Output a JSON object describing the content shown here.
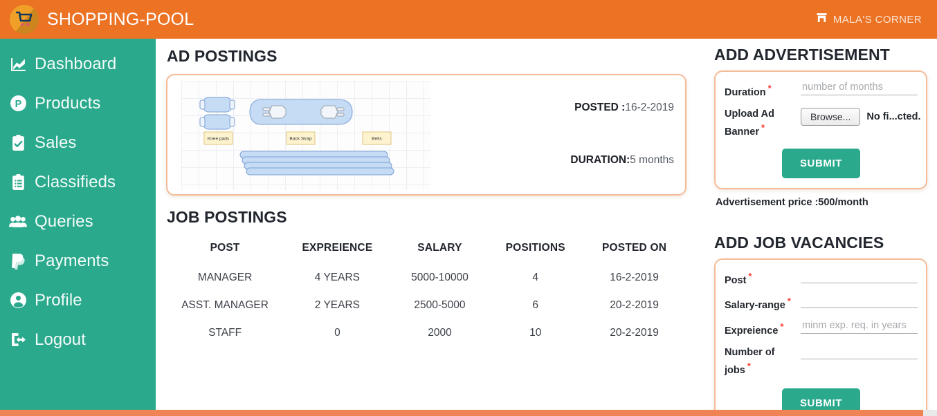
{
  "header": {
    "brand": "SHOPPING-POOL",
    "logo_icon": "shopping-cart-icon",
    "user_icon": "store-icon",
    "user_name": "MALA'S CORNER",
    "bg_color": "#ec7224"
  },
  "sidebar": {
    "bg_color": "#2aa98c",
    "items": [
      {
        "label": "Dashboard",
        "icon": "chart-line-icon"
      },
      {
        "label": "Products",
        "icon": "product-p-circle-icon"
      },
      {
        "label": "Sales",
        "icon": "clipboard-check-icon"
      },
      {
        "label": "Classifieds",
        "icon": "clipboard-list-icon"
      },
      {
        "label": "Queries",
        "icon": "users-icon"
      },
      {
        "label": "Payments",
        "icon": "paypal-icon"
      },
      {
        "label": "Profile",
        "icon": "user-circle-icon"
      },
      {
        "label": "Logout",
        "icon": "sign-out-icon"
      }
    ]
  },
  "main": {
    "ad_postings_title": "AD POSTINGS",
    "ad": {
      "posted_label": "POSTED :",
      "posted_value": "16-2-2019",
      "duration_label": "DURATION:",
      "duration_value": "5 months",
      "banner": {
        "alt": "advertisement banner diagram",
        "labels": [
          "Knee pads",
          "Back Strap",
          "Belts"
        ]
      }
    },
    "job_postings_title": "JOB POSTINGS",
    "jobs_table": {
      "columns": [
        "POST",
        "EXPREIENCE",
        "SALARY",
        "POSITIONS",
        "POSTED ON"
      ],
      "rows": [
        [
          "MANAGER",
          "4 YEARS",
          "5000-10000",
          "4",
          "16-2-2019"
        ],
        [
          "ASST. MANAGER",
          "2 YEARS",
          "2500-5000",
          "6",
          "20-2-2019"
        ],
        [
          "STAFF",
          "0",
          "2000",
          "10",
          "20-2-2019"
        ]
      ]
    }
  },
  "advertisement_form": {
    "title": "ADD ADVERTISEMENT",
    "duration_label": "Duration",
    "duration_value": "",
    "duration_placeholder": "number of months",
    "upload_label": "Upload Ad Banner",
    "browse_label": "Browse...",
    "file_status": "No fi...cted.",
    "submit_label": "SUBMIT",
    "price_note": "Advertisement price :500/month",
    "required_mark": "*"
  },
  "job_form": {
    "title": "ADD JOB VACANCIES",
    "fields": [
      {
        "label": "Post",
        "value": "",
        "placeholder": ""
      },
      {
        "label": "Salary-range",
        "value": "",
        "placeholder": ""
      },
      {
        "label": "Expreience",
        "value": "",
        "placeholder": "minm exp. req. in years"
      },
      {
        "label": "Number of jobs",
        "value": "",
        "placeholder": ""
      }
    ],
    "submit_label": "SUBMIT",
    "required_mark": "*"
  },
  "theme": {
    "orange": "#ec7224",
    "teal": "#2aa98c",
    "card_border": "#f5bb97",
    "footer": "#ef8354",
    "required_red": "#fb3b2e"
  }
}
